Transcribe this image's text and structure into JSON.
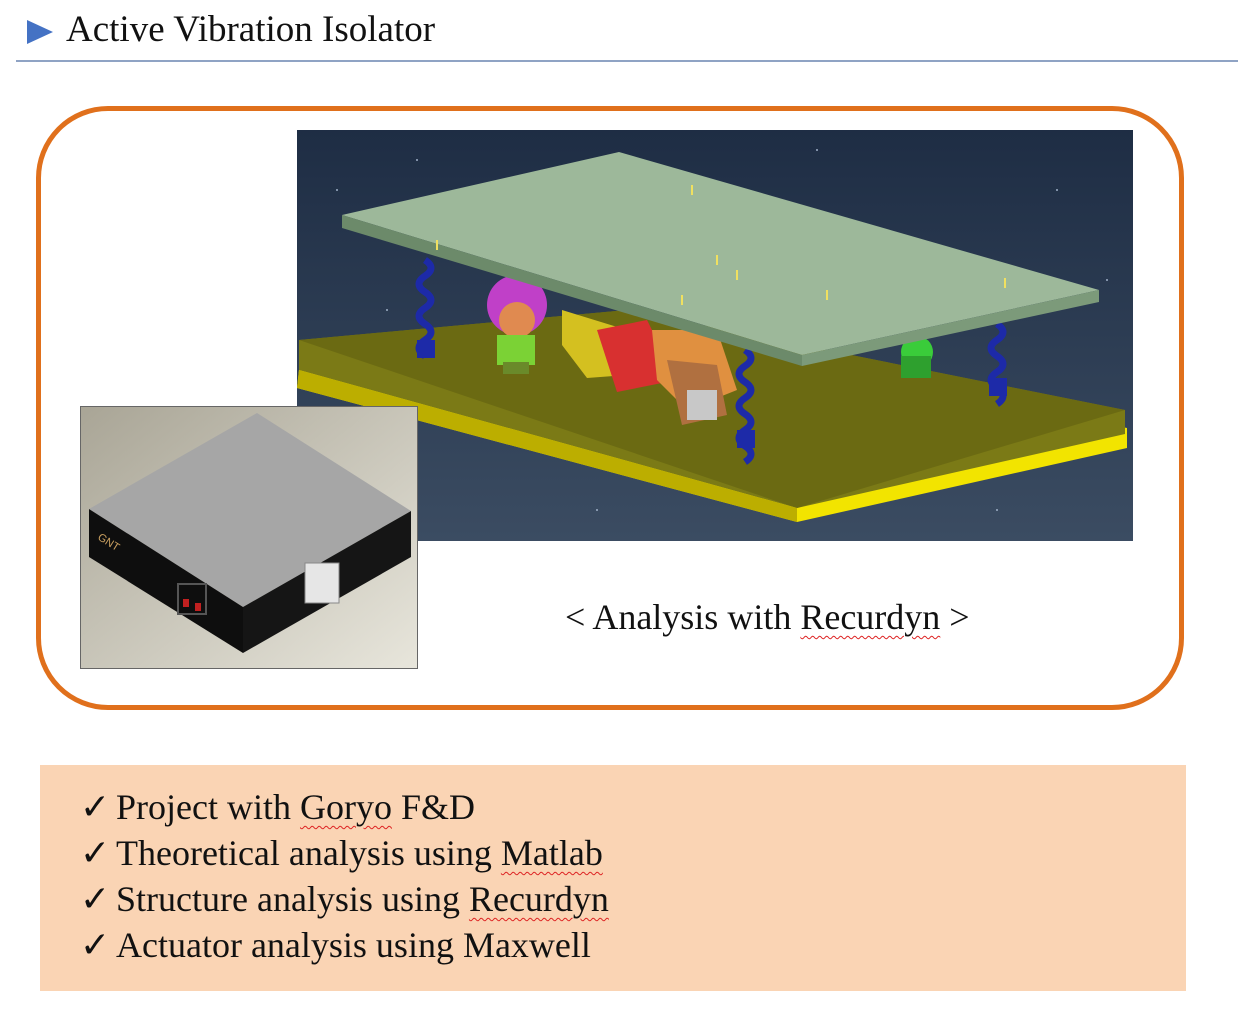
{
  "header": {
    "title": "Active Vibration Isolator",
    "arrow_color": "#4472c4"
  },
  "figure": {
    "caption_prefix": "< Analysis with ",
    "caption_keyword": "Recurdyn",
    "caption_suffix": " >",
    "box_label": "GNT",
    "frame_color": "#e0701c"
  },
  "bullets": {
    "check_mark": "✓",
    "items": [
      {
        "pre": "Project with ",
        "mark": "Goryo",
        "post": " F&D"
      },
      {
        "pre": "Theoretical analysis using ",
        "mark": "Matlab",
        "post": ""
      },
      {
        "pre": "Structure analysis using ",
        "mark": "Recurdyn",
        "post": ""
      },
      {
        "pre": "Actuator analysis using Maxwell",
        "mark": "",
        "post": ""
      }
    ],
    "background": "#fad4b4"
  }
}
